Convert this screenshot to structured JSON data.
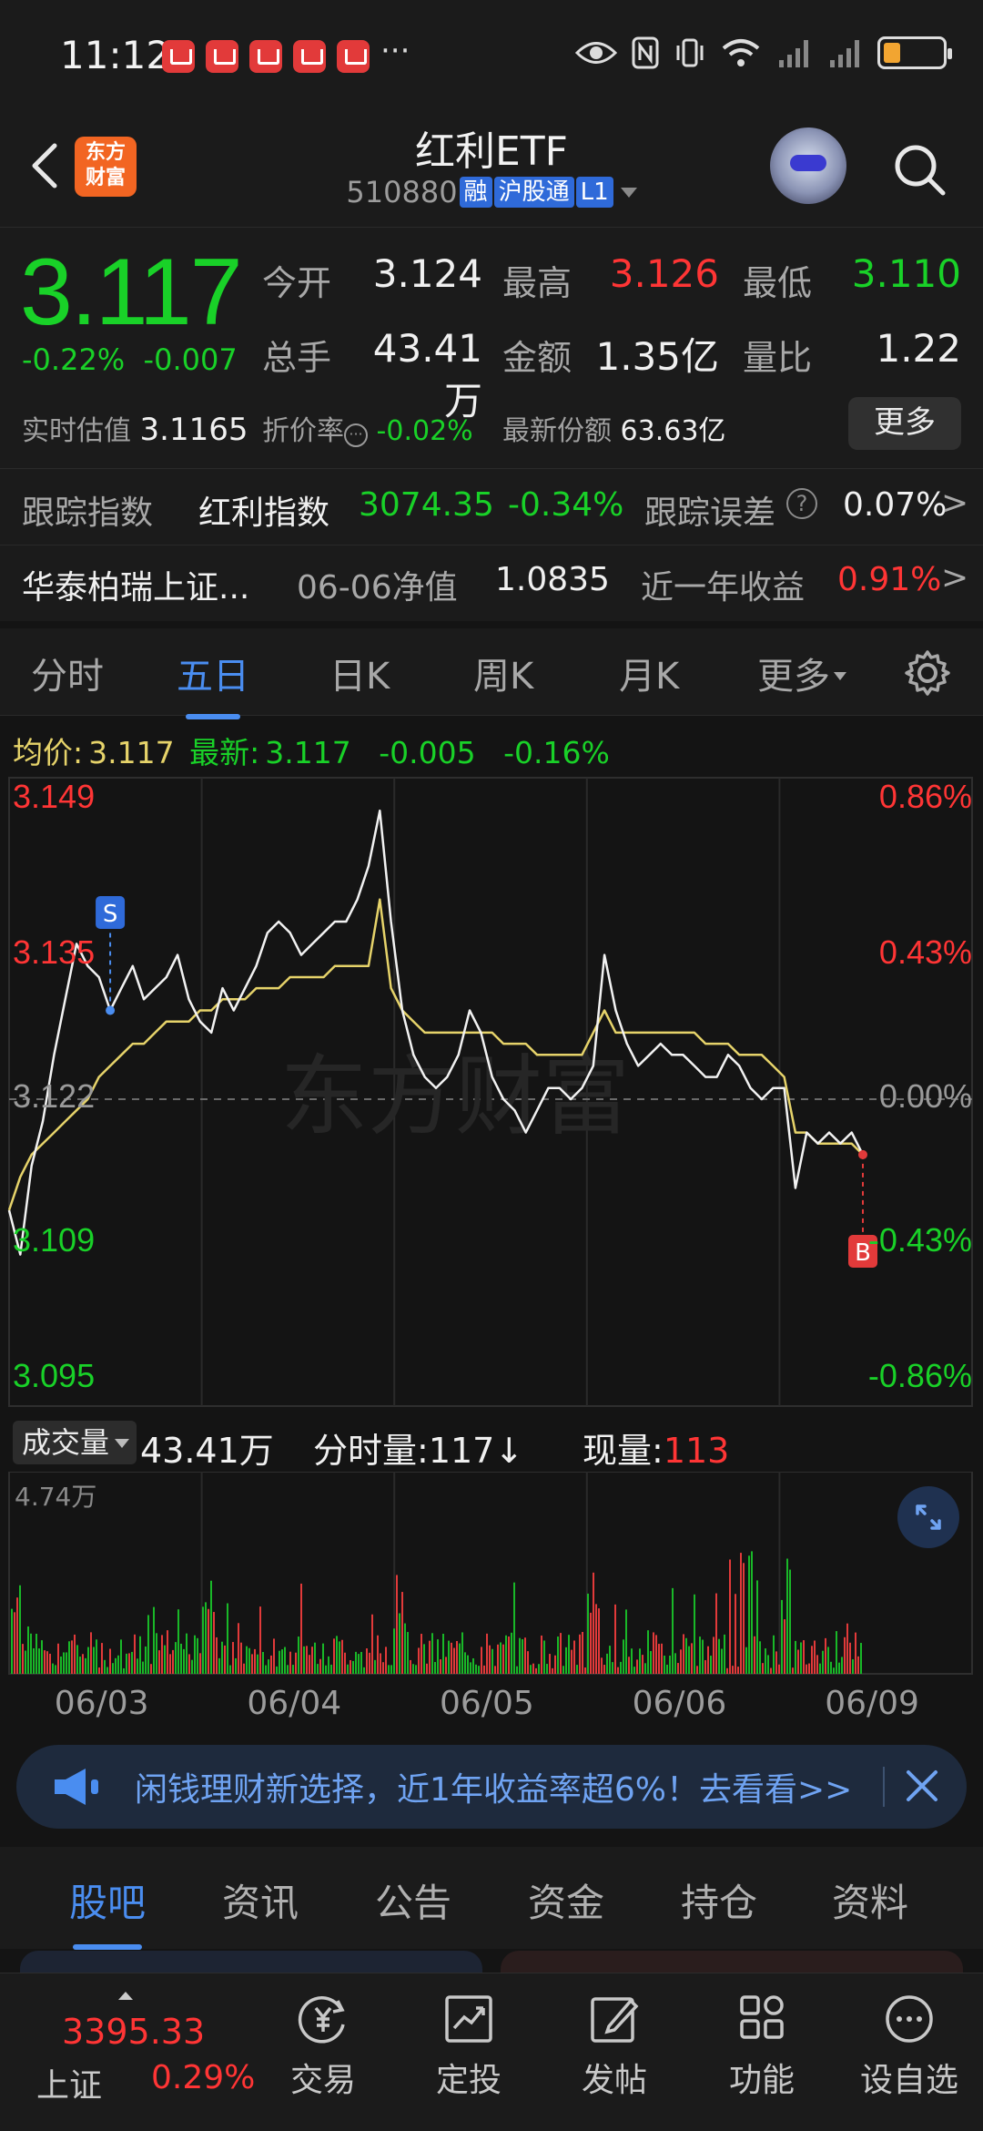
{
  "status_bar": {
    "time": "11:12",
    "more": "···",
    "battery_level": 0.2
  },
  "header": {
    "logo_line1": "东方",
    "logo_line2": "财富",
    "title": "红利ETF",
    "code": "510880",
    "tags": [
      "融",
      "沪股通",
      "L1"
    ]
  },
  "quote": {
    "price": "3.117",
    "change_pct": "-0.22%",
    "change": "-0.007",
    "open_label": "今开",
    "open": "3.124",
    "high_label": "最高",
    "high": "3.126",
    "low_label": "最低",
    "low": "3.110",
    "volume_label": "总手",
    "volume": "43.41万",
    "amount_label": "金额",
    "amount": "1.35亿",
    "ratio_label": "量比",
    "ratio": "1.22",
    "iopv_label": "实时估值",
    "iopv": "3.1165",
    "discount_label": "折价率",
    "discount": "-0.02%",
    "shares_label": "最新份额",
    "shares": "63.63亿",
    "more_button": "更多"
  },
  "tracking": {
    "label": "跟踪指数",
    "index_name": "红利指数",
    "index_value": "3074.35",
    "index_change": "-0.34%",
    "error_label": "跟踪误差",
    "error_value": "0.07%",
    "arrow": ">"
  },
  "fund": {
    "manager": "华泰柏瑞上证...",
    "nav_label": "06-06净值",
    "nav": "1.0835",
    "return_label": "近一年收益",
    "return_value": "0.91%",
    "arrow": ">"
  },
  "period_tabs": [
    "分时",
    "五日",
    "日K",
    "周K",
    "月K",
    "更多"
  ],
  "active_period": "五日",
  "chart_info": {
    "avg_label": "均价:",
    "avg": "3.117",
    "latest_label": "最新:",
    "latest": "3.117",
    "change": "-0.005",
    "change_pct": "-0.16%",
    "watermark": "东方财富",
    "sell_marker": "S",
    "buy_marker": "B"
  },
  "chart_data": {
    "type": "line",
    "x_ticks": [
      "06/03",
      "06/04",
      "06/05",
      "06/06",
      "06/09"
    ],
    "y_ticks_left": [
      "3.149",
      "3.135",
      "3.122",
      "3.109",
      "3.095"
    ],
    "y_ticks_right": [
      "0.86%",
      "0.43%",
      "0.00%",
      "-0.43%",
      "-0.86%"
    ],
    "ylim": [
      3.095,
      3.149
    ],
    "reference": 3.122,
    "series": [
      {
        "values": [
          3.112,
          3.108,
          3.116,
          3.12,
          3.126,
          3.131,
          3.136,
          3.134,
          3.133,
          3.13,
          3.132,
          3.134,
          3.131,
          3.132,
          3.133,
          3.135,
          3.131,
          3.129,
          3.128,
          3.132,
          3.13,
          3.132,
          3.134,
          3.137,
          3.138,
          3.137,
          3.135,
          3.136,
          3.137,
          3.138,
          3.138,
          3.14,
          3.143,
          3.148,
          3.138,
          3.13,
          3.126,
          3.124,
          3.123,
          3.124,
          3.126,
          3.13,
          3.128,
          3.124,
          3.122,
          3.121,
          3.119,
          3.121,
          3.123,
          3.123,
          3.122,
          3.123,
          3.125,
          3.135,
          3.13,
          3.127,
          3.125,
          3.126,
          3.127,
          3.126,
          3.126,
          3.125,
          3.124,
          3.124,
          3.126,
          3.125,
          3.123,
          3.122,
          3.123,
          3.123,
          3.114,
          3.119,
          3.118,
          3.119,
          3.118,
          3.119,
          3.117
        ]
      },
      {
        "values": [
          3.112,
          3.115,
          3.117,
          3.118,
          3.119,
          3.12,
          3.121,
          3.122,
          3.124,
          3.125,
          3.126,
          3.127,
          3.127,
          3.128,
          3.129,
          3.129,
          3.129,
          3.13,
          3.13,
          3.131,
          3.131,
          3.131,
          3.132,
          3.132,
          3.132,
          3.133,
          3.133,
          3.133,
          3.133,
          3.134,
          3.134,
          3.134,
          3.134,
          3.14,
          3.132,
          3.13,
          3.129,
          3.128,
          3.128,
          3.128,
          3.128,
          3.128,
          3.128,
          3.128,
          3.127,
          3.127,
          3.127,
          3.126,
          3.126,
          3.126,
          3.126,
          3.126,
          3.128,
          3.13,
          3.128,
          3.128,
          3.128,
          3.128,
          3.128,
          3.128,
          3.128,
          3.128,
          3.127,
          3.127,
          3.127,
          3.126,
          3.126,
          3.126,
          3.125,
          3.124,
          3.119,
          3.119,
          3.118,
          3.118,
          3.118,
          3.118,
          3.117
        ]
      }
    ]
  },
  "volume": {
    "selector": "成交量",
    "total": "43.41万",
    "tick_label": "分时量:",
    "tick_volume": "117",
    "tick_arrow": "↓",
    "current_label": "现量:",
    "current": "113",
    "max_label": "4.74万"
  },
  "banner": {
    "text": "闲钱理财新选择，近1年收益率超6%！去看看>>"
  },
  "content_tabs": [
    "股吧",
    "资讯",
    "公告",
    "资金",
    "持仓",
    "资料"
  ],
  "active_content_tab": "股吧",
  "bottom_bar": {
    "index_value": "3395.33",
    "index_name": "上证",
    "index_pct": "0.29%",
    "items": [
      "交易",
      "定投",
      "发帖",
      "功能",
      "设自选"
    ]
  },
  "colors": {
    "up": "#ff3535",
    "down": "#19d128",
    "accent": "#4a8df0",
    "avg_line": "#e6d36a"
  }
}
